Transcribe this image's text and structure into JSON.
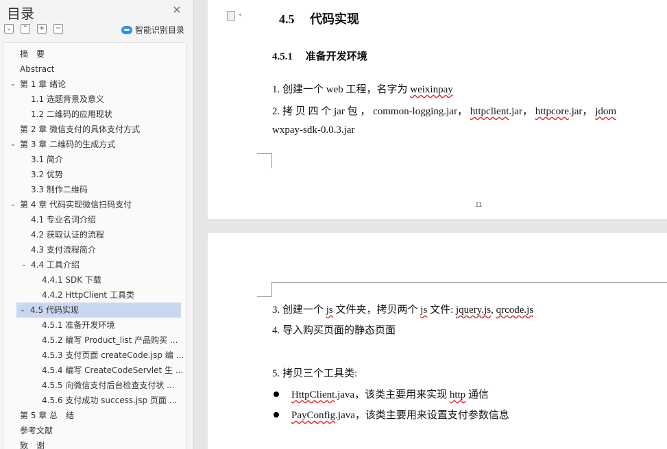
{
  "sidebar": {
    "title": "目录",
    "close_icon": "close-icon",
    "tools": [
      "collapse-all-icon",
      "expand-all-icon",
      "add-icon",
      "remove-icon"
    ],
    "smart_label": "智能识别目录",
    "toc": [
      {
        "label": "摘　要",
        "level": 0,
        "chevron": false
      },
      {
        "label": "Abstract",
        "level": 0,
        "chevron": false
      },
      {
        "label": "第 1 章  绪论",
        "level": 0,
        "chevron": true
      },
      {
        "label": "1.1  选题背景及意义",
        "level": 1,
        "chevron": false
      },
      {
        "label": "1.2  二维码的应用现状",
        "level": 1,
        "chevron": false
      },
      {
        "label": "第 2 章  微信支付的具体支付方式",
        "level": 0,
        "chevron": false
      },
      {
        "label": "第 3 章  二维码的生成方式",
        "level": 0,
        "chevron": true
      },
      {
        "label": "3.1  简介",
        "level": 1,
        "chevron": false
      },
      {
        "label": "3.2  优势",
        "level": 1,
        "chevron": false
      },
      {
        "label": "3.3  制作二维码",
        "level": 1,
        "chevron": false
      },
      {
        "label": "第 4 章  代码实现微信扫码支付",
        "level": 0,
        "chevron": true
      },
      {
        "label": "4.1  专业名词介绍",
        "level": 1,
        "chevron": false
      },
      {
        "label": "4.2  获取认证的流程",
        "level": 1,
        "chevron": false
      },
      {
        "label": "4.3  支付流程简介",
        "level": 1,
        "chevron": false
      },
      {
        "label": "4.4  工具介绍",
        "level": 1,
        "chevron": true
      },
      {
        "label": "4.4.1  SDK 下载",
        "level": 2,
        "chevron": false
      },
      {
        "label": "4.4.2  HttpClient 工具类",
        "level": 2,
        "chevron": false
      },
      {
        "label": "4.5  代码实现",
        "level": 1,
        "chevron": true,
        "selected": true
      },
      {
        "label": "4.5.1  准备开发环境",
        "level": 2,
        "chevron": false
      },
      {
        "label": "4.5.2  编写 Product_list 产品购买 ...",
        "level": 2,
        "chevron": false
      },
      {
        "label": "4.5.3  支付页面 createCode.jsp 编 ...",
        "level": 2,
        "chevron": false
      },
      {
        "label": "4.5.4  编写 CreateCodeServlet 生 ...",
        "level": 2,
        "chevron": false
      },
      {
        "label": "4.5.5  向微信支付后台检查支付状 ...",
        "level": 2,
        "chevron": false
      },
      {
        "label": "4.5.6  支付成功 success.jsp 页面 ...",
        "level": 2,
        "chevron": false
      },
      {
        "label": "第 5 章  总　结",
        "level": 0,
        "chevron": false
      },
      {
        "label": "参考文献",
        "level": 0,
        "chevron": false
      },
      {
        "label": "致　谢",
        "level": 0,
        "chevron": false
      }
    ]
  },
  "doc": {
    "page1": {
      "heading2": "4.5　 代码实现",
      "heading3": "4.5.1　 准备开发环境",
      "line1_prefix": "1. 创建一个 web 工程，名字为 ",
      "line1_code": "weixinpay",
      "line2_prefix": "2. 拷  贝  四  个  jar  包  ，  common-logging.jar，  ",
      "line2_a": "httpclient",
      "line2_b": ".jar，  ",
      "line2_c": "httpcore",
      "line2_d": ".jar，  ",
      "line2_e": "jdom",
      "line3": "wxpay-sdk-0.0.3.jar",
      "page_number": "11"
    },
    "page2": {
      "line3_a": "3. 创建一个 ",
      "line3_js1": "js",
      "line3_b": " 文件夹，拷贝两个 ",
      "line3_js2": "js",
      "line3_c": " 文件: ",
      "line3_jq": "jquery.js",
      "line3_d": ", ",
      "line3_qr": "qrcode.js",
      "line4": "4. 导入购买页面的静态页面",
      "line5": "5. 拷贝三个工具类:",
      "bullet1_code": "HttpClient",
      "bullet1_rest": ".java，该类主要用来实现 ",
      "bullet1_http": "http",
      "bullet1_end": " 通信",
      "bullet2_code": "PayConfig",
      "bullet2_rest": ".java，该类主要用来设置支付参数信息"
    }
  }
}
